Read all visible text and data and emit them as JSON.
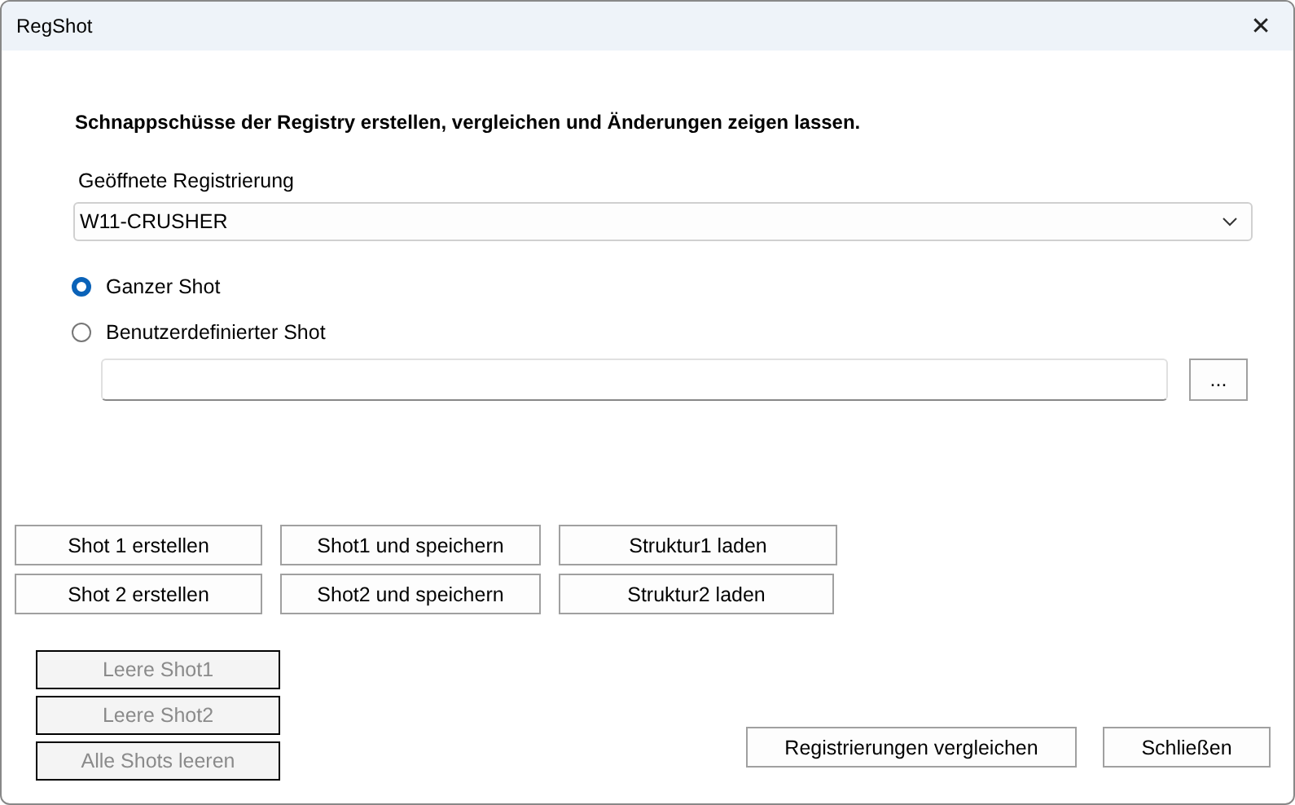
{
  "window": {
    "title": "RegShot",
    "close": "✕"
  },
  "description": "Schnappschüsse der Registry erstellen, vergleichen und Änderungen zeigen lassen.",
  "registry": {
    "label": "Geöffnete Registrierung",
    "value": "W11-CRUSHER"
  },
  "shot_type": [
    {
      "label": "Ganzer Shot",
      "selected": true
    },
    {
      "label": "Benutzerdefinierter Shot",
      "selected": false
    }
  ],
  "path": {
    "browse": "..."
  },
  "shot_buttons": [
    [
      {
        "label": "Shot 1 erstellen"
      },
      {
        "label": "Shot1 und speichern"
      },
      {
        "label": "Struktur1 laden"
      }
    ],
    [
      {
        "label": "Shot 2 erstellen"
      },
      {
        "label": "Shot2 und speichern"
      },
      {
        "label": "Struktur2 laden"
      }
    ]
  ],
  "clear_buttons": [
    {
      "label": "Leere Shot1",
      "disabled": true
    },
    {
      "label": "Leere Shot2",
      "disabled": true
    },
    {
      "label": "Alle Shots leeren",
      "disabled": true
    }
  ],
  "dialog_buttons": [
    {
      "label": "Registrierungen vergleichen"
    },
    {
      "label": "Schließen"
    }
  ]
}
